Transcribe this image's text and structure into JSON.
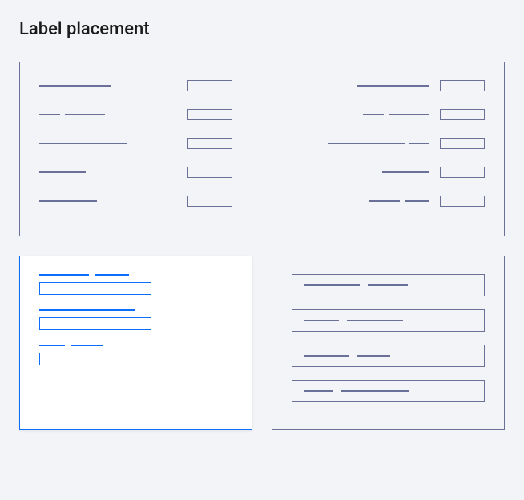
{
  "heading": "Label placement",
  "colors": {
    "border_default": "#6b7099",
    "border_selected": "#0d6efd",
    "bg_canvas": "#f3f4f7",
    "bg_selected": "#ffffff"
  },
  "layouts": [
    {
      "id": "left-aligned-horizontal",
      "selected": false
    },
    {
      "id": "right-aligned-horizontal",
      "selected": false
    },
    {
      "id": "top-aligned-stacked",
      "selected": true
    },
    {
      "id": "inline-inside-input",
      "selected": false
    }
  ]
}
